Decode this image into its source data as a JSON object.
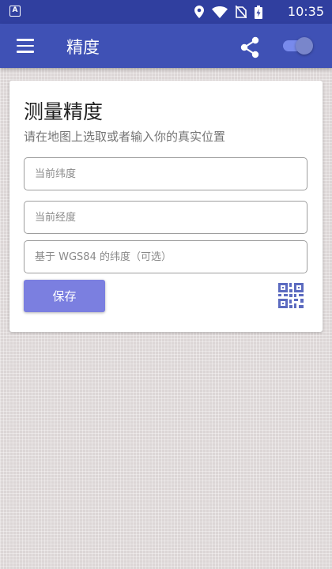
{
  "status_bar": {
    "time": "10:35",
    "icons": [
      "app-a-icon",
      "location-icon",
      "wifi-icon",
      "no-sim-icon",
      "battery-charging-icon"
    ]
  },
  "app_bar": {
    "title": "精度",
    "icons": [
      "menu-icon",
      "share-icon"
    ],
    "toggle_on": true
  },
  "card": {
    "title": "测量精度",
    "subtitle": "请在地图上选取或者输入你的真实位置",
    "fields": {
      "latitude_placeholder": "当前纬度",
      "longitude_placeholder": "当前经度",
      "wgs84_placeholder": "基于 WGS84 的纬度（可选）"
    },
    "save_label": "保存",
    "qr_icon": "qr-code-scan-icon"
  },
  "colors": {
    "status_bar": "#303f9f",
    "app_bar": "#3f51b5",
    "button": "#7b7fe0",
    "qr": "#5c6bc0"
  }
}
